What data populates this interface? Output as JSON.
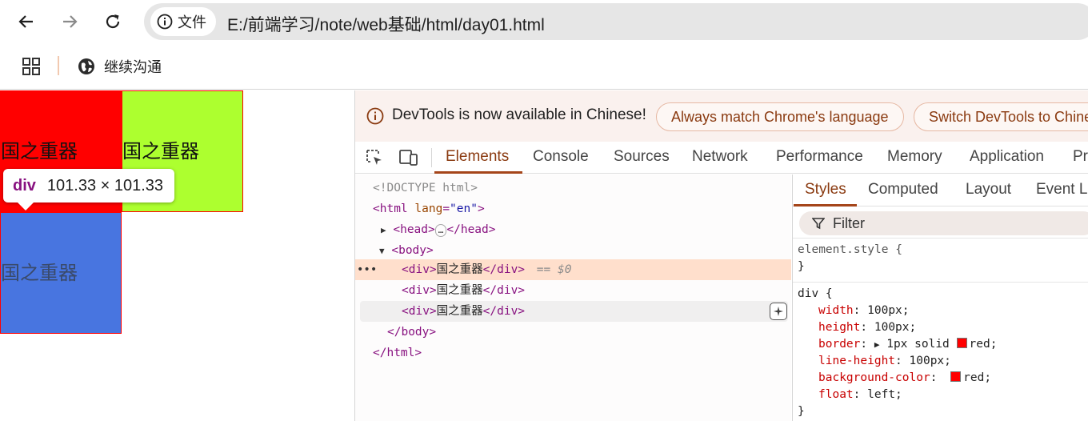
{
  "toolbar": {
    "back_icon": "back-arrow-icon",
    "forward_icon": "forward-arrow-icon",
    "reload_icon": "reload-icon",
    "site_info_label": "文件",
    "url": "E:/前端学习/note/web基础/html/day01.html"
  },
  "bookmarks": {
    "apps_icon": "apps-grid-icon",
    "items": [
      {
        "label": "继续沟通",
        "icon": "globe-icon"
      }
    ]
  },
  "page": {
    "boxes": [
      {
        "text": "国之重器",
        "color": "#ff0000"
      },
      {
        "text": "国之重器",
        "color": "#adff2f"
      },
      {
        "text": "国之重器",
        "color": "#4875e0"
      }
    ],
    "tooltip": {
      "tag": "div",
      "size": "101.33 × 101.33"
    }
  },
  "devtools": {
    "infobar": {
      "message": "DevTools is now available in Chinese!",
      "match_button": "Always match Chrome's language",
      "switch_button": "Switch DevTools to Chine"
    },
    "tabs": [
      "Elements",
      "Console",
      "Sources",
      "Network",
      "Performance",
      "Memory",
      "Application",
      "Pr"
    ],
    "dom": {
      "doctype": "<!DOCTYPE html>",
      "html_open_tag": "<html",
      "html_attr_name": "lang",
      "html_attr_value": "\"en\"",
      "head_open": "<head>",
      "head_ellipsis": "…",
      "head_close": "</head>",
      "body_open": "<body>",
      "div_open": "<div>",
      "div_text": "国之重器",
      "div_close": "</div>",
      "selected_marker": "== $0",
      "body_close": "</body>",
      "html_close": "</html>"
    },
    "styles": {
      "tabs": [
        "Styles",
        "Computed",
        "Layout",
        "Event Li"
      ],
      "filter_placeholder": "Filter",
      "element_style_selector": "element.style {",
      "close_brace": "}",
      "div_selector": "div {",
      "declarations": [
        {
          "prop": "width",
          "value": "100px;"
        },
        {
          "prop": "height",
          "value": "100px;"
        },
        {
          "prop": "border",
          "value": "1px solid",
          "color_value": "red;"
        },
        {
          "prop": "line-height",
          "value": "100px;"
        },
        {
          "prop": "background-color",
          "color_value": "red;"
        },
        {
          "prop": "float",
          "value": "left;"
        }
      ]
    }
  }
}
